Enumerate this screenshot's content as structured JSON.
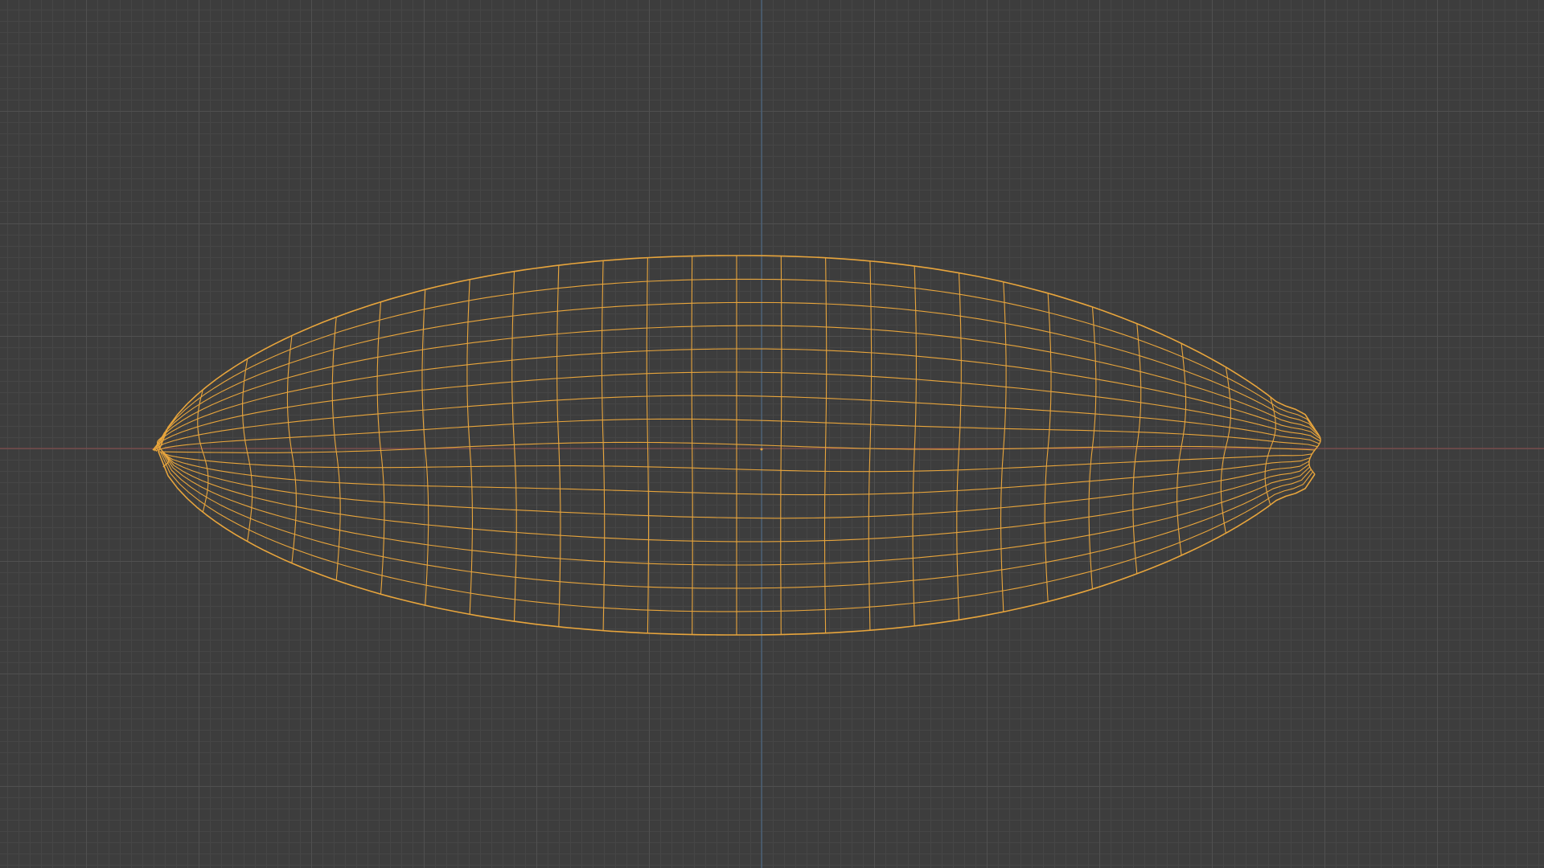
{
  "viewport": {
    "view": "orthographic",
    "grid_visible": true,
    "axes_visible": [
      "x",
      "y"
    ],
    "object_selected": true
  },
  "colors": {
    "background": "#3d3d3d",
    "grid_minor": "#464646",
    "grid_major": "#505050",
    "axis_x": "#8a4a4a",
    "axis_y": "#4a6a8a",
    "wire_selected": "#e8a53c",
    "origin_point": "#e8a53c"
  },
  "object": {
    "shape_name": "ellipsoid-mesh",
    "wireframe": true,
    "selected": true
  }
}
